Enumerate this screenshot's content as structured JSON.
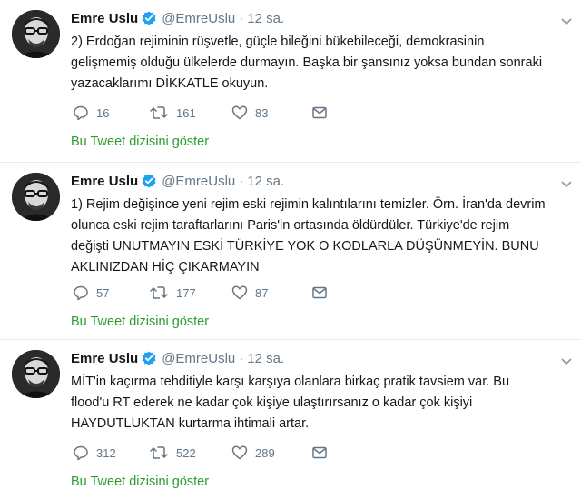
{
  "tweets": [
    {
      "name": "Emre Uslu",
      "handle": "@EmreUslu",
      "separator": "·",
      "time": "12 sa.",
      "lines": [
        "2) Erdoğan rejiminin rüşvetle, güçle bileğini bükebileceği, demokrasinin",
        "gelişmemiş olduğu ülkelerde durmayın. Başka bir şansınız yoksa bundan sonraki",
        "yazacaklarımı DİKKATLE okuyun."
      ],
      "replies": "16",
      "retweets": "161",
      "likes": "83",
      "thread_link": "Bu Tweet dizisini göster"
    },
    {
      "name": "Emre Uslu",
      "handle": "@EmreUslu",
      "separator": "·",
      "time": "12 sa.",
      "lines": [
        "1) Rejim değişince yeni rejim eski rejimin kalıntılarını temizler. Örn. İran'da devrim",
        "olunca eski rejim taraftarlarını Paris'in ortasında öldürdüler. Türkiye'de rejim",
        "değişti UNUTMAYIN ESKİ TÜRKİYE YOK O KODLARLA DÜŞÜNMEYİN. BUNU",
        "AKLINIZDAN HİÇ ÇIKARMAYIN"
      ],
      "replies": "57",
      "retweets": "177",
      "likes": "87",
      "thread_link": "Bu Tweet dizisini göster"
    },
    {
      "name": "Emre Uslu",
      "handle": "@EmreUslu",
      "separator": "·",
      "time": "12 sa.",
      "lines": [
        "MİT'in kaçırma tehditiyle karşı karşıya olanlara birkaç pratik tavsiem var. Bu",
        "flood'u RT ederek ne kadar çok kişiye ulaştırırsanız o kadar çok kişiyi",
        "HAYDUTLUKTAN kurtarma ihtimali artar."
      ],
      "replies": "312",
      "retweets": "522",
      "likes": "289",
      "thread_link": "Bu Tweet dizisini göster"
    }
  ],
  "colors": {
    "verified": "#1da1f2",
    "thread_link": "#2b9d2b",
    "muted": "#657786"
  },
  "icons": [
    "verified-badge-icon",
    "reply-icon",
    "retweet-icon",
    "like-icon",
    "direct-message-icon",
    "chevron-down-icon"
  ]
}
